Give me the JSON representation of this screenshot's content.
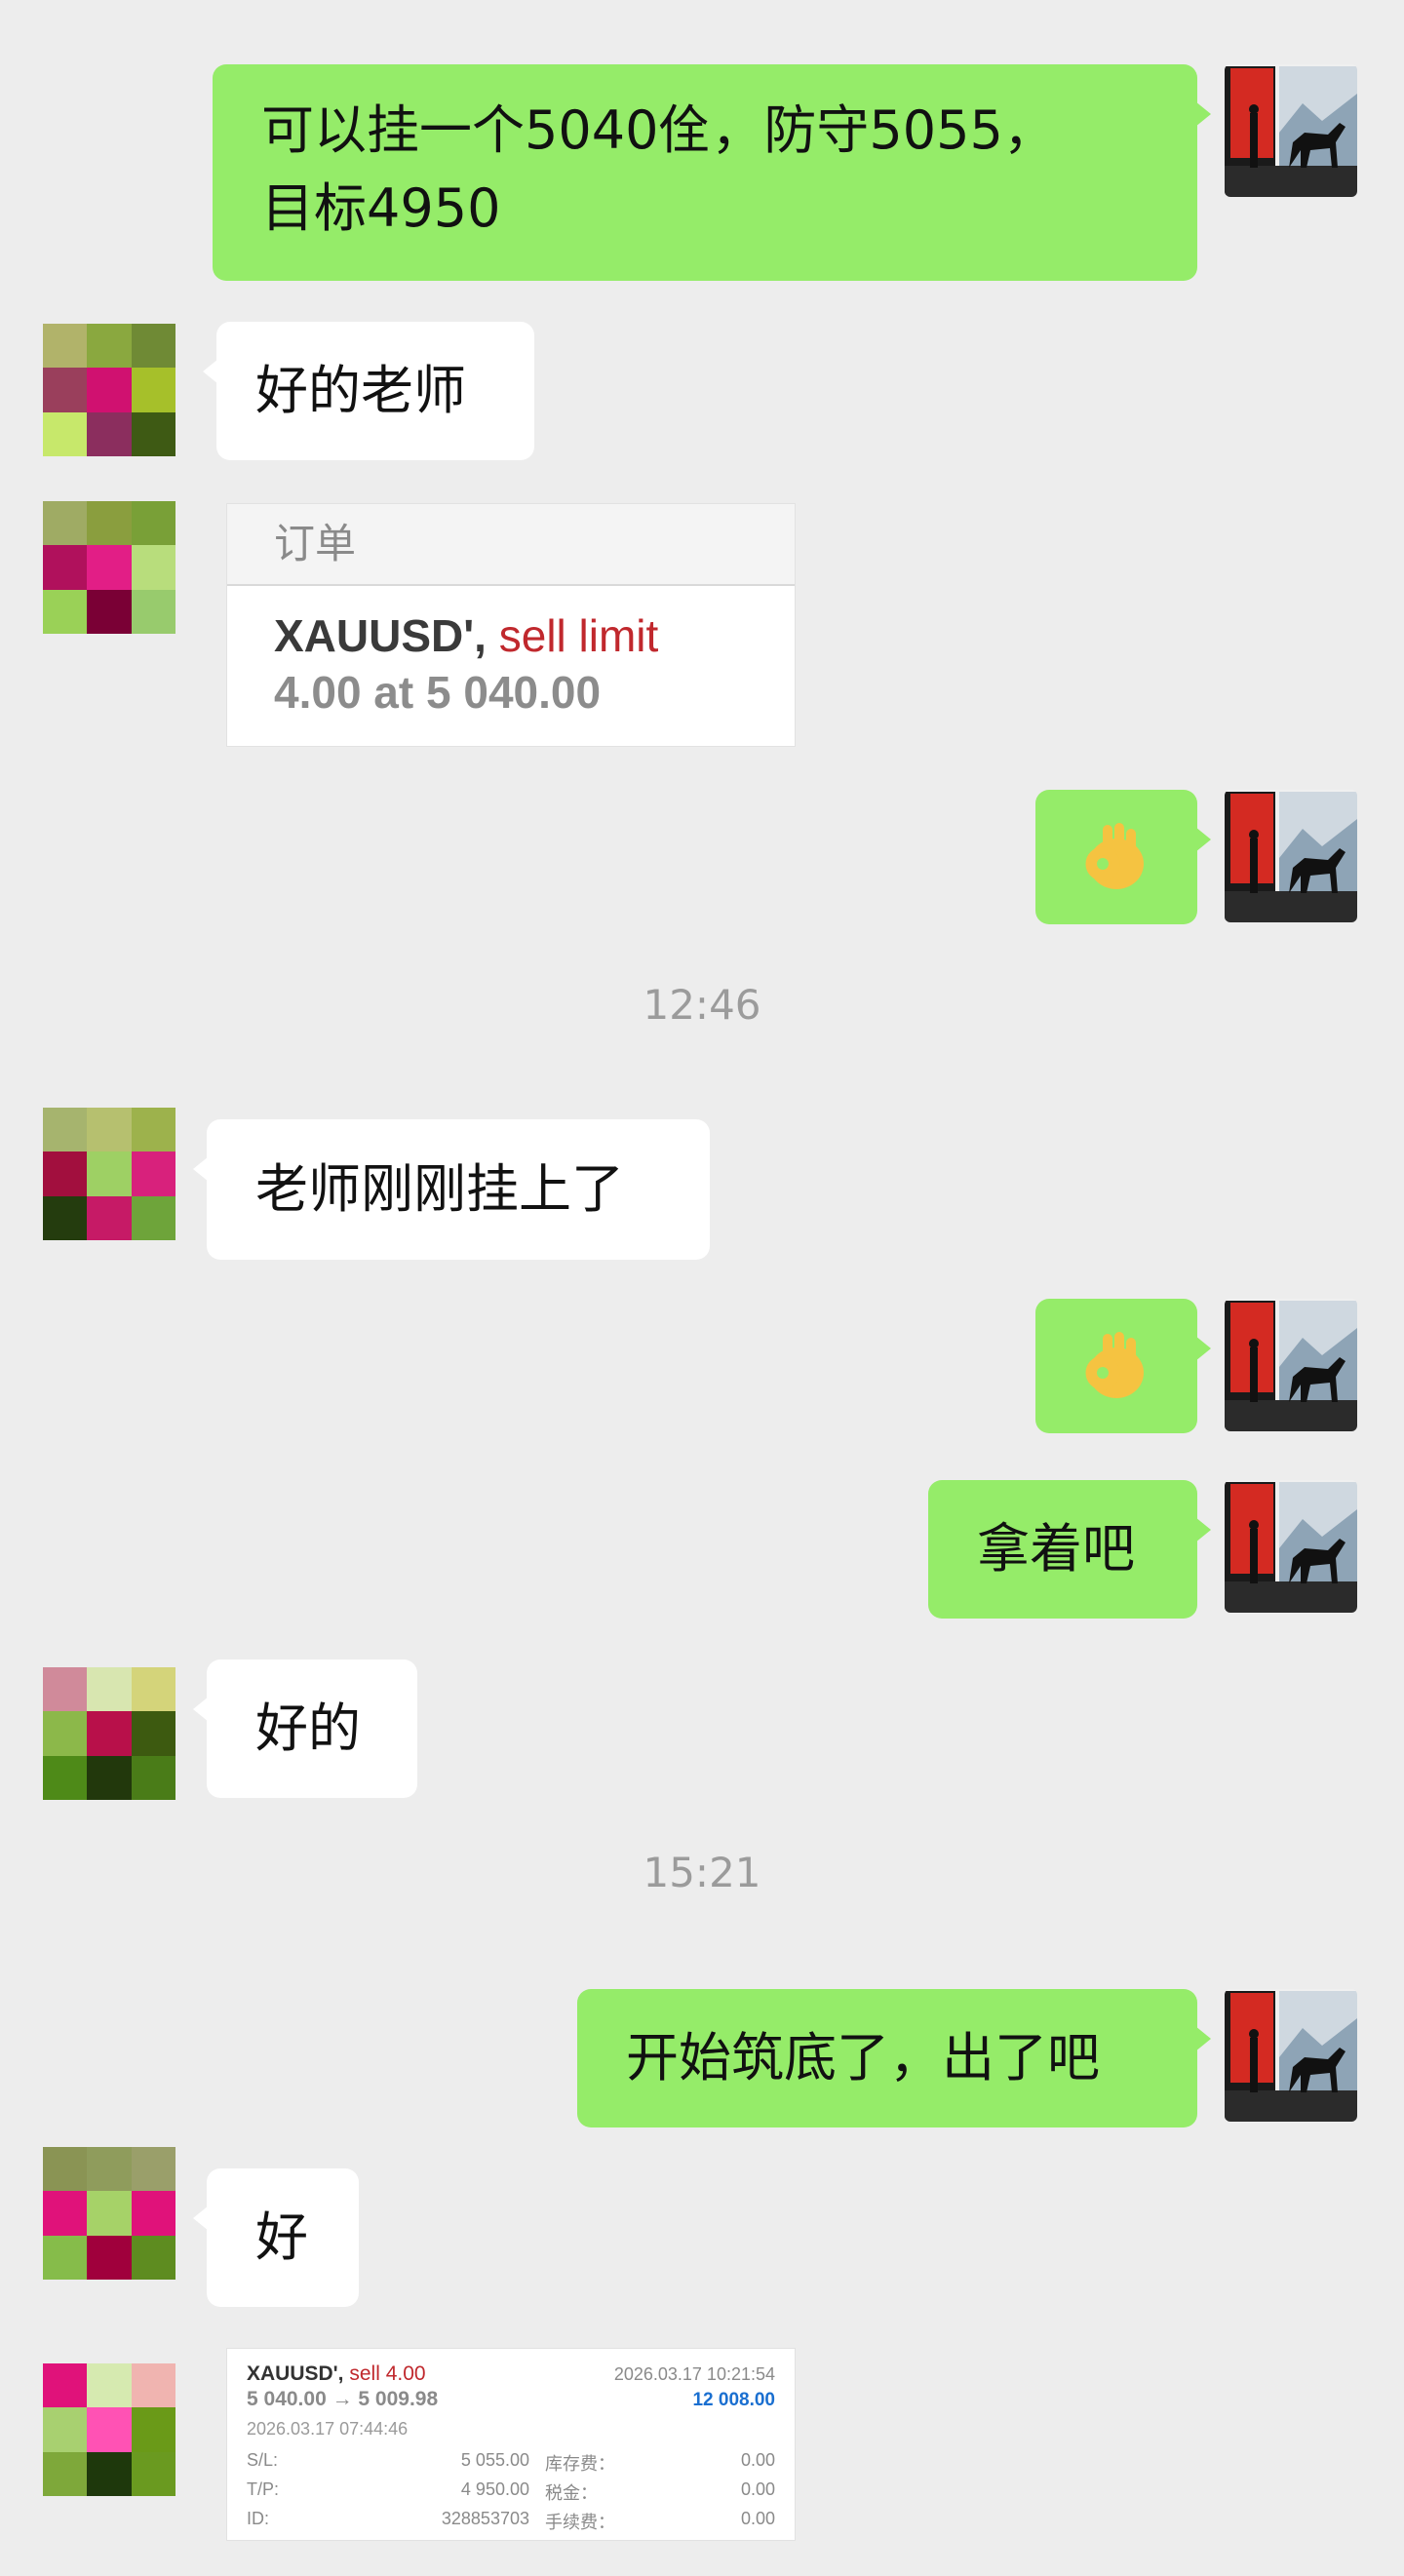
{
  "messages": {
    "m1": {
      "line1": "可以挂一个5040佺，防守5055，",
      "line2": "目标4950"
    },
    "m2": "好的老师",
    "m3": {
      "card_title": "订单",
      "symbol": "XAUUSD',",
      "order_type": "sell limit",
      "detail": "4.00 at 5 040.00"
    },
    "m4": {
      "emoji": "ok-hand-emoji"
    },
    "m5": "老师刚刚挂上了",
    "m6": {
      "emoji": "ok-hand-emoji"
    },
    "m7": "拿着吧",
    "m8": "好的",
    "m9": "开始筑底了，出了吧",
    "m10": "好",
    "m11": {
      "symbol": "XAUUSD',",
      "side": "sell 4.00",
      "close_time": "2026.03.17 10:21:54",
      "prices": "5 040.00 → 5 009.98",
      "profit": "12 008.00",
      "open_time": "2026.03.17 07:44:46",
      "sl_label": "S/L:",
      "sl_value": "5 055.00",
      "tp_label": "T/P:",
      "tp_value": "4 950.00",
      "id_label": "ID:",
      "id_value": "328853703",
      "swap_label": "库存费：",
      "swap_value": "0.00",
      "tax_label": "税金：",
      "tax_value": "0.00",
      "fee_label": "手续费：",
      "fee_value": "0.00"
    }
  },
  "timestamps": {
    "t1": "12:46",
    "t2": "15:21"
  },
  "colors": {
    "background": "#ededed",
    "self_bubble": "#95ec69",
    "other_bubble": "#ffffff",
    "sell_red": "#c0282d",
    "profit_blue": "#1a6fd0"
  }
}
